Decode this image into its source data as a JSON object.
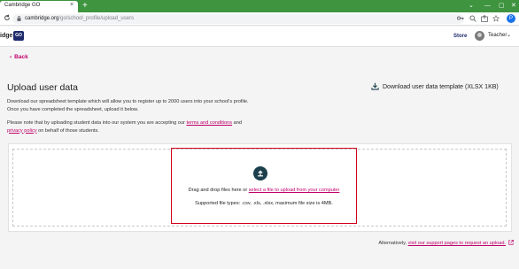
{
  "browser": {
    "tab_title": "Cambridge GO",
    "tab_close": "×",
    "new_tab": "+",
    "window_controls": [
      "⌄",
      "—",
      "▢",
      "✕"
    ],
    "url_host": "cambridge.org",
    "url_path": "/go/school_profile/upload_users",
    "profile_initial": "P"
  },
  "header": {
    "logo_text": "idge",
    "logo_badge": "GO",
    "store_label": "Store",
    "user_label": "Teacher",
    "user_caret": "⌄"
  },
  "main": {
    "back_arrow": "‹",
    "back_label": "Back",
    "title": "Upload user data",
    "download_label": "Download user data template (XLSX 1KB)",
    "intro_line1": "Download our spreadsheet template which will allow you to register up to 2000 users into your school's profile.",
    "intro_line2": "Once you have completed the spreadsheet, upload it below.",
    "notice_prefix": "Please note that by uploading student data into our system you are accepting our ",
    "terms_link": "terms and conditions",
    "notice_and": " and",
    "privacy_link": "privacy policy",
    "notice_suffix": " on behalf of those students.",
    "drop_text_prefix": "Drag and drop files here or ",
    "drop_select_link": "select a file to upload from your computer",
    "drop_types": "Supported file types: .csv, .xls, .xlsx, maximum file size is 4MB.",
    "alt_prefix": "Alternatively, ",
    "alt_link": "visit our support pages to request an upload."
  },
  "colors": {
    "accent_link": "#c0006a",
    "browser_green": "#3f9440",
    "highlight_red": "#d0021b",
    "upload_icon_bg": "#1c3f4c"
  },
  "icons": [
    "reload-icon",
    "lock-icon",
    "key-icon",
    "zoom-icon",
    "share-icon",
    "star-icon",
    "download-icon",
    "upload-icon",
    "external-link-icon"
  ]
}
